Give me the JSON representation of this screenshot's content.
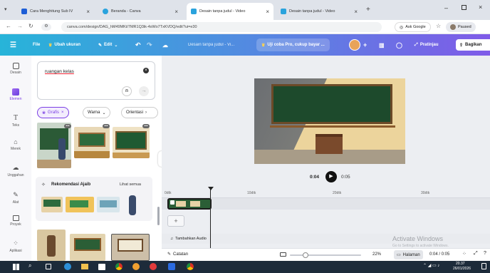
{
  "browser": {
    "tabs": [
      {
        "title": "Cara Menghitung Sub IV",
        "color": "#1e5ed6"
      },
      {
        "title": "Beranda - Canva",
        "color": "#2aa3dd"
      },
      {
        "title": "Desain tanpa judul - Video",
        "color": "#2aa3dd"
      },
      {
        "title": "Desain tanpa judul - Video",
        "color": "#2aa3dd"
      }
    ],
    "url": "canva.com/design/DAG_hM49MKt/7MR1Q3ik-4sWo7TxKVDQ/edit?ui=e30",
    "ask_google": "Ask Google",
    "paused": "Paused"
  },
  "header": {
    "file": "File",
    "resize": "Ubah ukuran",
    "edit": "Edit",
    "title": "Desain tanpa judul - Vi...",
    "try_pro": "Uji coba Pro, cukup bayar ...",
    "preview": "Pratinjau",
    "share": "Bagikan"
  },
  "rail": [
    {
      "label": "Desain",
      "icon": "design-icon"
    },
    {
      "label": "Elemen",
      "icon": "elements-icon"
    },
    {
      "label": "Teks",
      "icon": "text-icon"
    },
    {
      "label": "Merek",
      "icon": "brand-icon"
    },
    {
      "label": "Unggahan",
      "icon": "uploads-icon"
    },
    {
      "label": "Alat",
      "icon": "draw-icon"
    },
    {
      "label": "Proyek",
      "icon": "projects-icon"
    },
    {
      "label": "Aplikasi",
      "icon": "apps-icon"
    }
  ],
  "panel": {
    "search_value": "ruangan kelas",
    "filters": [
      "Grafis",
      "Warna",
      "Orientasi"
    ],
    "magic": "Rekomendasi Ajaib",
    "see_all": "Lihat semua"
  },
  "player": {
    "current": "0:04",
    "total": "0:05"
  },
  "ruler": [
    "0dtk",
    "10dtk",
    "20dtk",
    "30dtk"
  ],
  "timeline": {
    "add_audio": "Tambahkan Audio"
  },
  "bottom": {
    "notes": "Catatan",
    "zoom": "22%",
    "page": "Halaman",
    "time": "0:04 / 0:05"
  },
  "watermark": {
    "title": "Activate Windows",
    "sub": "Go to Settings to activate Windows."
  },
  "taskbar": {
    "time": "20.37",
    "date": "26/01/2026"
  }
}
